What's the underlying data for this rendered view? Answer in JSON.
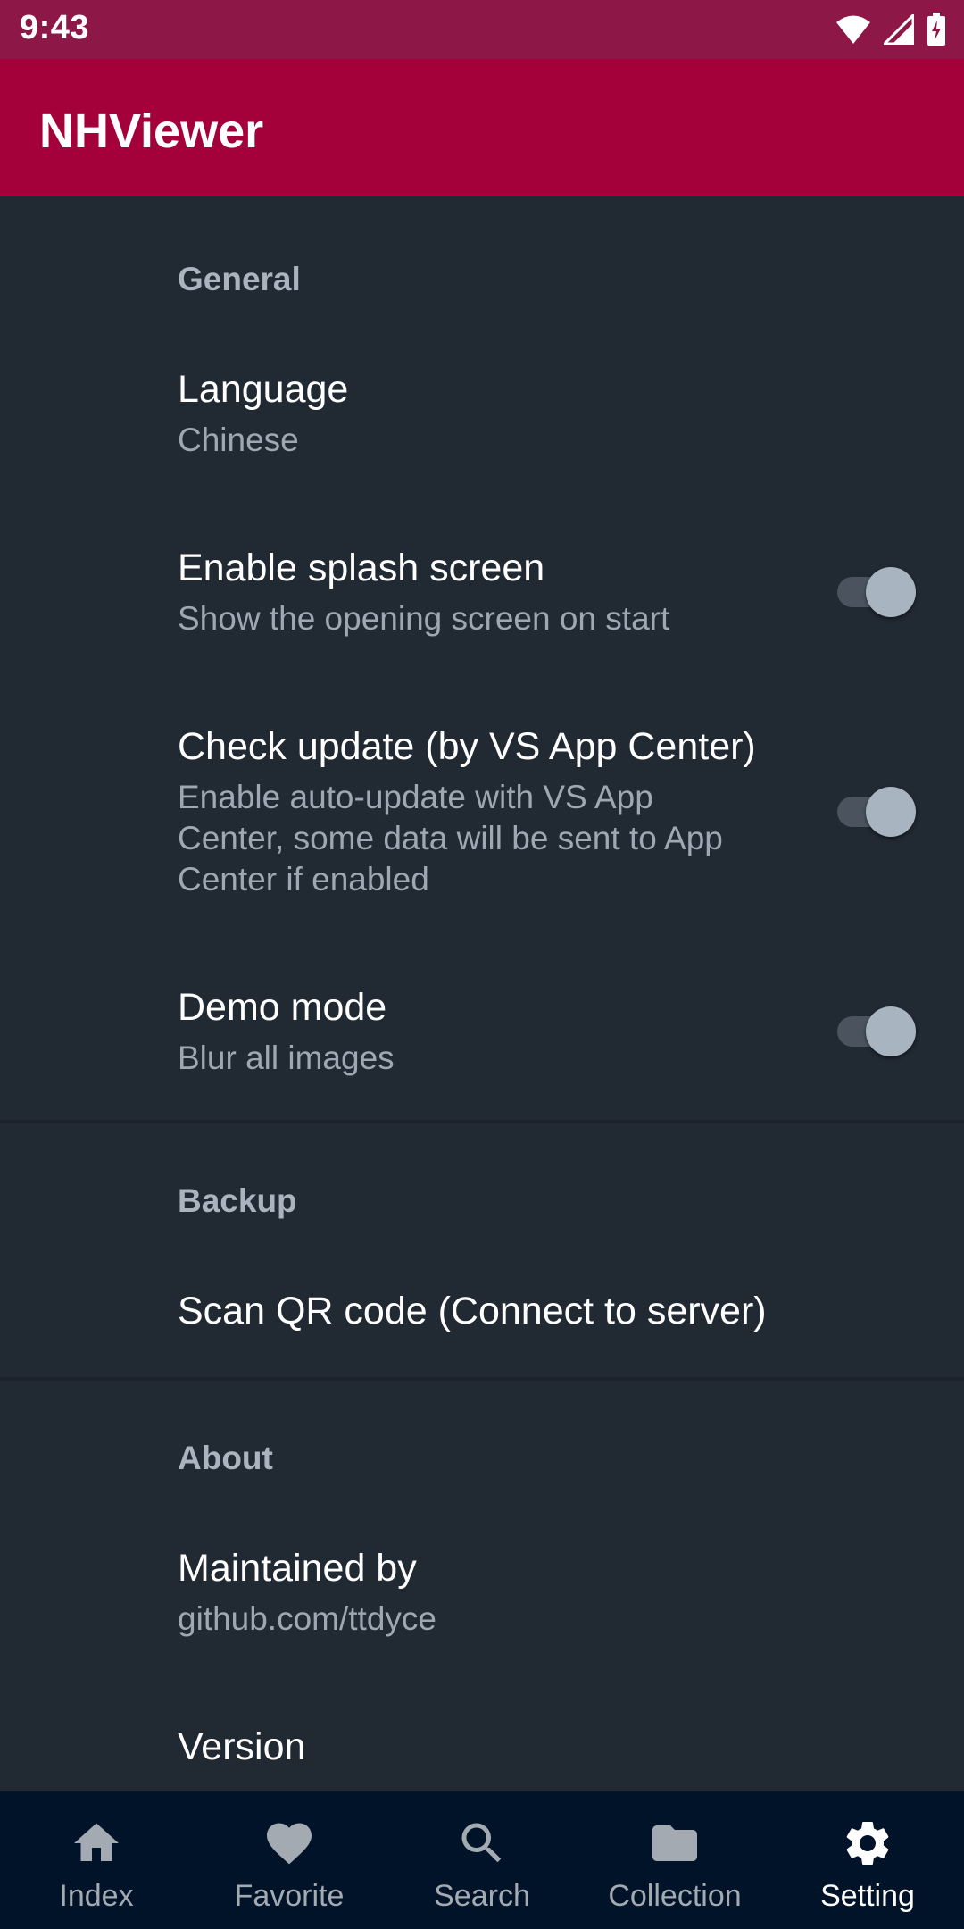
{
  "status_bar": {
    "time": "9:43"
  },
  "app_bar": {
    "title": "NHViewer"
  },
  "sections": {
    "general": {
      "header": "General",
      "language": {
        "title": "Language",
        "summary": "Chinese"
      },
      "splash": {
        "title": "Enable splash screen",
        "summary": "Show the opening screen on start",
        "enabled": true
      },
      "update": {
        "title": "Check update (by VS App Center)",
        "summary_lines": [
          "Enable auto-update with VS App",
          "Center, some data will be sent to App",
          "Center if enabled"
        ],
        "enabled": true
      },
      "demo": {
        "title": "Demo mode",
        "summary": "Blur all images",
        "enabled": true
      }
    },
    "backup": {
      "header": "Backup",
      "scan": {
        "title": "Scan QR code (Connect to server)"
      }
    },
    "about": {
      "header": "About",
      "maintained": {
        "title": "Maintained by",
        "summary": "github.com/ttdyce"
      },
      "version": {
        "title": "Version"
      }
    }
  },
  "bottom_nav": {
    "items": [
      {
        "label": "Index",
        "icon": "home-icon"
      },
      {
        "label": "Favorite",
        "icon": "heart-icon"
      },
      {
        "label": "Search",
        "icon": "search-icon"
      },
      {
        "label": "Collection",
        "icon": "folder-icon"
      },
      {
        "label": "Setting",
        "icon": "gear-icon",
        "active": true
      }
    ]
  },
  "colors": {
    "status_bar": "#8d1848",
    "app_bar": "#a4003a",
    "background": "#212933",
    "bottom_nav": "#001329"
  }
}
